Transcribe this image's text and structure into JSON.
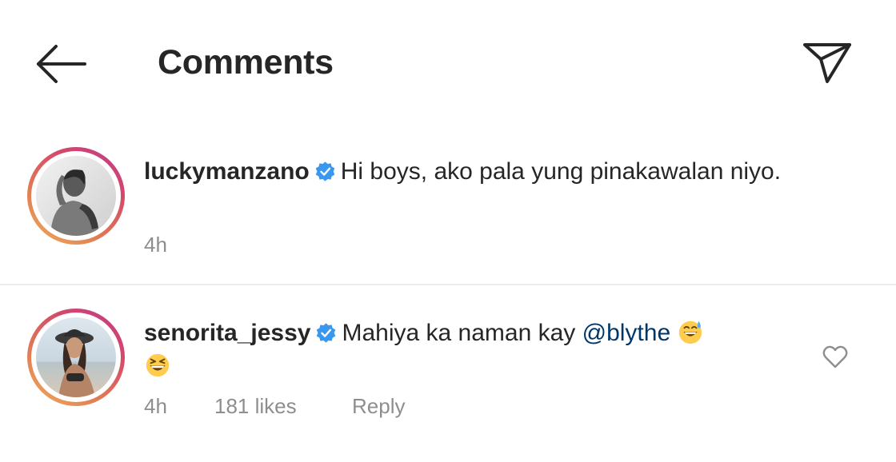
{
  "header": {
    "title": "Comments",
    "back_icon": "arrow-left-icon",
    "share_icon": "paper-plane-icon"
  },
  "comments": [
    {
      "username": "luckymanzano",
      "verified": true,
      "text": "Hi boys, ako pala yung pinakawalan niyo.",
      "time": "4h"
    },
    {
      "username": "senorita_jessy",
      "verified": true,
      "text_before_mention": "Mahiya ka naman kay ",
      "mention": "@blythe",
      "emojis": [
        "grinning-sweat-emoji",
        "grinning-squint-emoji"
      ],
      "time": "4h",
      "likes": "181 likes",
      "reply_label": "Reply"
    }
  ],
  "colors": {
    "text": "#262626",
    "secondary": "#8e8e8e",
    "verified_blue": "#3897f0",
    "mention": "#00376b",
    "divider": "#ececec"
  }
}
